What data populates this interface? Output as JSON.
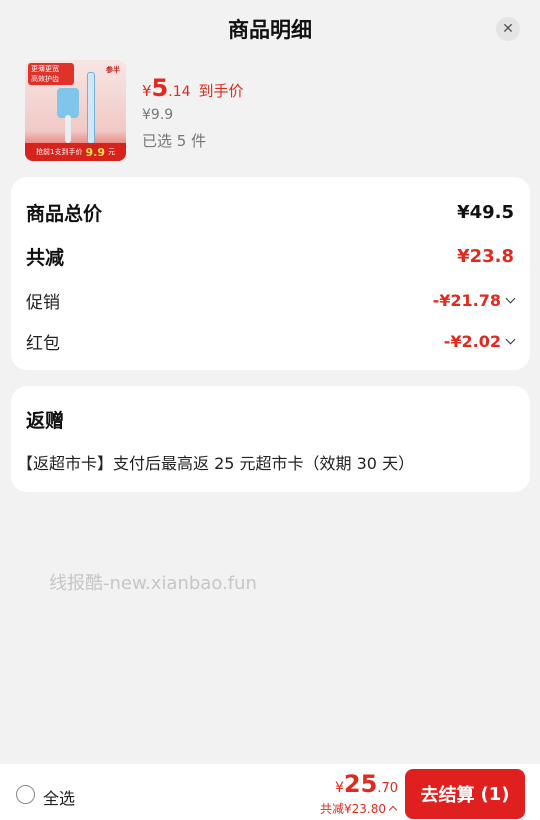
{
  "header": {
    "title": "商品明细",
    "close_icon": "close-icon"
  },
  "product": {
    "thumb": {
      "tag_line1": "更薄更宽",
      "tag_line2": "高效护齿",
      "brand": "参半",
      "badge_prefix": "抢前1支到手价",
      "badge_price": "9.9",
      "badge_suffix": "元"
    },
    "price_yen": "¥",
    "price_int": "5",
    "price_dec": ".14",
    "price_label": "到手价",
    "original_price": "¥9.9",
    "selected_qty": "已选 5 件"
  },
  "summary": {
    "total_label": "商品总价",
    "total_value": "¥49.5",
    "discount_label": "共减",
    "discount_value": "¥23.8",
    "promo_label": "促销",
    "promo_value": "-¥21.78",
    "redpacket_label": "红包",
    "redpacket_value": "-¥2.02"
  },
  "gift": {
    "heading": "返赠",
    "description": "【返超市卡】支付后最高返 25 元超市卡（效期 30 天）"
  },
  "watermark": "线报酷-new.xianbao.fun",
  "bottom": {
    "select_all": "全选",
    "total_yen": "¥",
    "total_int": "25",
    "total_dec": ".70",
    "saved_text": "共减¥23.80",
    "checkout_label": "去结算",
    "checkout_count": "(1)"
  },
  "colors": {
    "accent_red": "#e02a1f",
    "background": "#f2f2f2"
  }
}
